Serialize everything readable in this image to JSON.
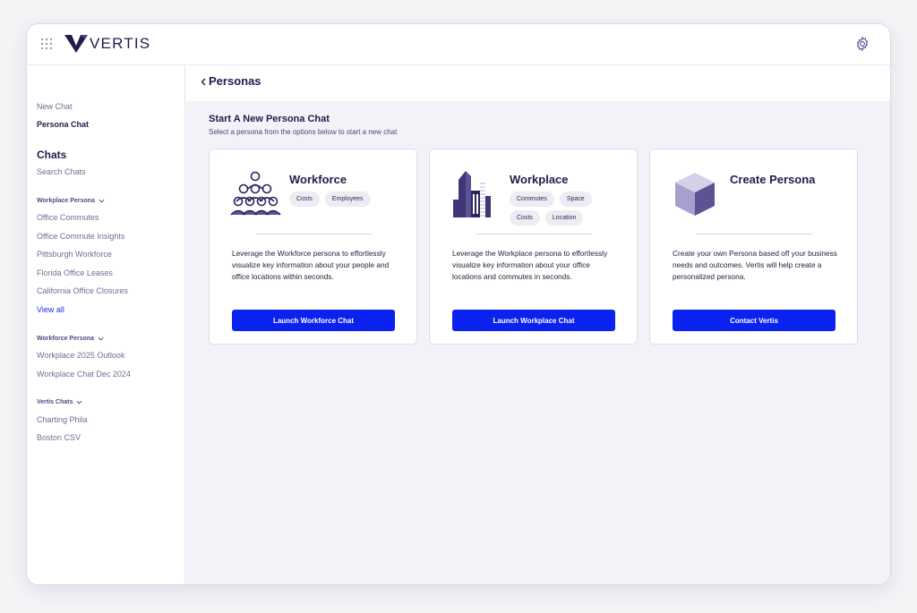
{
  "app": {
    "logo_text": "VERTIS"
  },
  "sidebar": {
    "new_chat": "New Chat",
    "persona_chat": "Persona Chat",
    "chats_heading": "Chats",
    "search_chats": "Search Chats",
    "groups": [
      {
        "label": "Workplace Persona",
        "items": [
          "Office Commutes",
          "Office Commute Insights",
          "Pittsburgh Workforce",
          "Florida Office Leases",
          "California Office Closures"
        ],
        "view_all": "View all"
      },
      {
        "label": "Workforce Persona",
        "items": [
          "Workplace 2025 Outlook",
          "Workplace Chat Dec 2024"
        ]
      },
      {
        "label": "Vertis Chats",
        "items": [
          "Charting Phila",
          "Boston CSV"
        ]
      }
    ]
  },
  "main": {
    "title": "Personas",
    "section_title": "Start A New Persona Chat",
    "section_subtitle": "Select a persona from the options below to start a new chat",
    "cards": [
      {
        "title": "Workforce",
        "tags": [
          "Costs",
          "Employees"
        ],
        "description": "Leverage the Workforce persona to effortlessly visualize key information about your people and office locations within seconds.",
        "button": "Launch Workforce Chat",
        "icon": "people-group-icon"
      },
      {
        "title": "Workplace",
        "tags": [
          "Commutes",
          "Space",
          "Costs",
          "Location"
        ],
        "description": "Leverage the Workplace persona to effortlessly visualize key information about your office locations and commutes in seconds.",
        "button": "Launch Workplace Chat",
        "icon": "buildings-icon"
      },
      {
        "title": "Create Persona",
        "tags": [],
        "description": "Create your own Persona based off your business needs and outcomes. Vertis will help create a personalized persona.",
        "button": "Contact Vertis",
        "icon": "cube-icon"
      }
    ]
  },
  "colors": {
    "primary": "#0a22f0",
    "navy": "#1f1d4a",
    "muted": "#6f6e94",
    "accent_purple": "#5b5394"
  }
}
